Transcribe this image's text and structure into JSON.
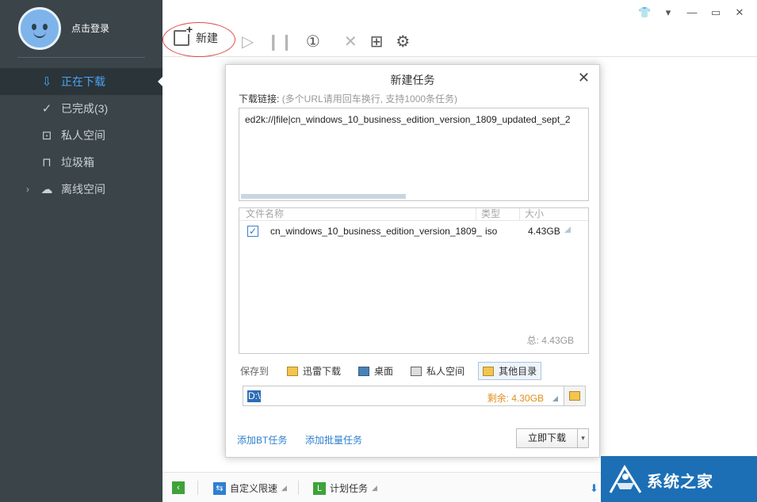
{
  "sidebar": {
    "login_text": "点击登录",
    "items": [
      {
        "label": "正在下载",
        "icon": "download-icon",
        "active": true
      },
      {
        "label": "已完成(3)",
        "icon": "check-circle-icon"
      },
      {
        "label": "私人空间",
        "icon": "lock-icon"
      },
      {
        "label": "垃圾箱",
        "icon": "trash-icon"
      },
      {
        "label": "离线空间",
        "icon": "cloud-icon"
      }
    ]
  },
  "toolbar": {
    "new_label": "新建"
  },
  "dialog": {
    "title": "新建任务",
    "link_label": "下载链接:",
    "link_hint": "(多个URL请用回车换行, 支持1000条任务)",
    "url_value": "ed2k://|file|cn_windows_10_business_edition_version_1809_updated_sept_2",
    "columns": {
      "name": "文件名称",
      "type": "类型",
      "size": "大小"
    },
    "file": {
      "name": "cn_windows_10_business_edition_version_1809_...",
      "type": "iso",
      "size": "4.43GB",
      "checked": true
    },
    "total": "总: 4.43GB",
    "save_to_label": "保存到",
    "save_options": [
      {
        "label": "迅雷下载"
      },
      {
        "label": "桌面"
      },
      {
        "label": "私人空间"
      },
      {
        "label": "其他目录",
        "selected": true
      }
    ],
    "path": "D:\\",
    "remaining": "剩余: 4.30GB",
    "add_bt": "添加BT任务",
    "add_batch": "添加批量任务",
    "download_now": "立即下载"
  },
  "bottombar": {
    "speed_limit": "自定义限速",
    "schedule": "计划任务"
  },
  "watermark": {
    "text": "系统之家"
  },
  "colors": {
    "sidebar_bg": "#3a4449",
    "accent": "#4aa3f0",
    "link": "#2f7fd0",
    "annotation": "#e04a4a"
  }
}
